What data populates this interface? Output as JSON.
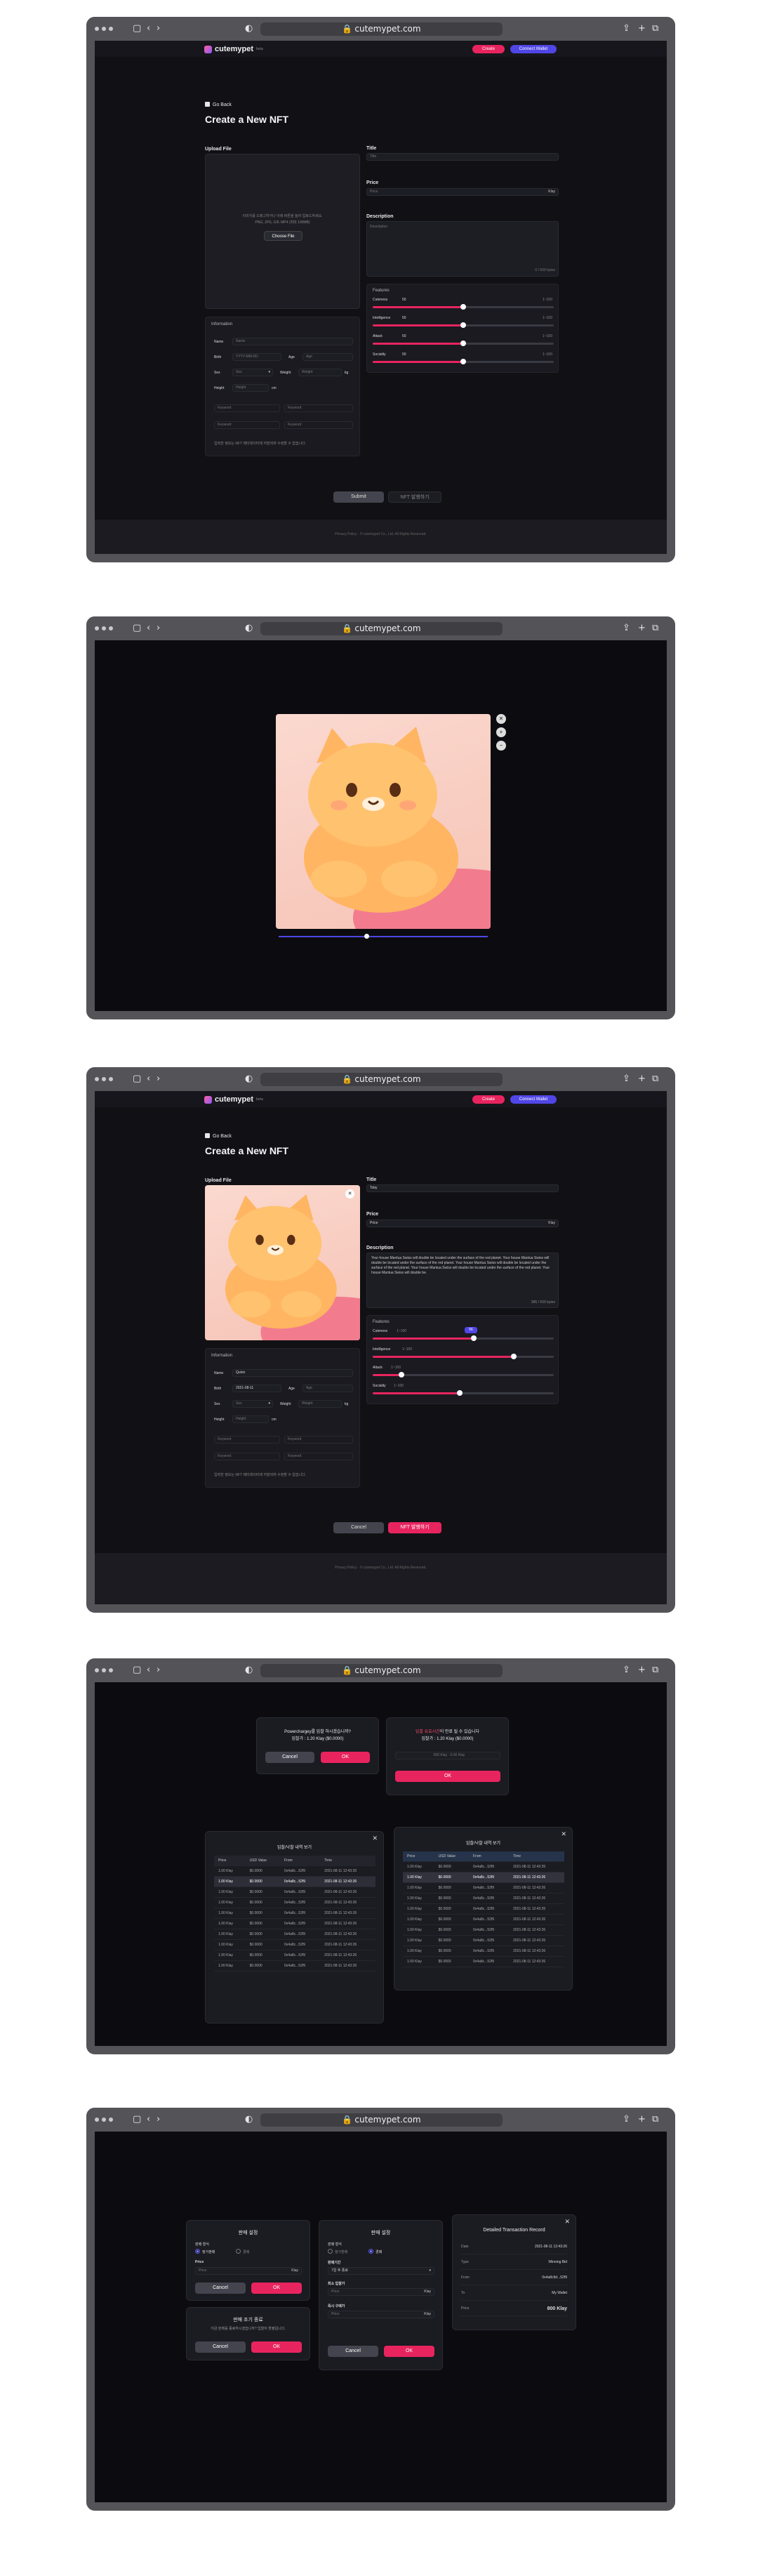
{
  "browser": {
    "url": "cutemypet.com"
  },
  "header": {
    "logo": "cutemypet",
    "logo_badge": "beta",
    "create_label": "Create",
    "connect_label": "Connect Wallet"
  },
  "page": {
    "back_label": "Go Back",
    "title": "Create a New NFT"
  },
  "upload": {
    "label": "Upload File",
    "hint_line1": "이미지를 드래그하거나 아래 버튼을 눌러 업로드하세요.",
    "hint_line2": "PNG, JPG, GIF, MP4 (최대 100MB)",
    "choose_label": "Choose File"
  },
  "form": {
    "title_label": "Title",
    "title_placeholder": "Title",
    "title_value": "Toby",
    "price_label": "Price",
    "price_placeholder": "Price",
    "price_value": "Price",
    "price_unit": "Klay",
    "description_label": "Description",
    "description_placeholder": "Description",
    "description_count": "0 / 500 bytes",
    "description_count_filled": "385 / 500 bytes",
    "description_text": "Your house Mantua Swiss will double be located under the surface of the red planet. Your house Mantua Swiss will double be located under the surface of the red planet. Your house Mantua Swiss will double be located under the surface of the red planet. Your house Mantua Swiss will double be located under the surface of the red planet. Your house Mantua Swiss will double be."
  },
  "features": {
    "label": "Features",
    "items": [
      {
        "name": "Cuteness",
        "value": "50",
        "hint": "1~100",
        "level": 0.5
      },
      {
        "name": "Intelligence",
        "value": "50",
        "hint": "1~100",
        "level": 0.5
      },
      {
        "name": "Attack",
        "value": "50",
        "hint": "1~100",
        "level": 0.5
      },
      {
        "name": "Sociality",
        "value": "50",
        "hint": "1~100",
        "level": 0.5
      }
    ],
    "filled_levels": [
      0.56,
      0.78,
      0.16,
      0.48
    ],
    "tooltip": "56"
  },
  "information": {
    "label": "Information",
    "name_label": "Name",
    "name_placeholder": "Name",
    "name_value": "Quinn",
    "birth_label": "Birth",
    "birth_placeholder": "YYYY-MM-DD",
    "birth_value": "2021-08-11",
    "age_label": "Age",
    "age_placeholder": "Age",
    "sex_label": "Sex",
    "sex_value": "Sex",
    "weight_label": "Weight",
    "weight_placeholder": "Weight",
    "weight_unit": "kg",
    "height_label": "Height",
    "height_placeholder": "Height",
    "height_unit": "cm",
    "keyword1": "Keyword",
    "keyword2": "Keyword",
    "keyword3": "Keyword",
    "keyword4": "Keyword",
    "note": "입력한 정보는 NFT 메타데이터에 저장되며 수정할 수 없습니다."
  },
  "actions": {
    "cancel": "Cancel",
    "submit": "Submit",
    "submit_alt": "NFT 발행하기"
  },
  "footer": {
    "text": "Privacy Policy · © cutemypet Co., Ltd. All Rights Reserved."
  },
  "dialogs": {
    "confirm1_line1": "Powerchargey를 입찰 하시겠습니까?",
    "confirm1_line2": "입찰가 : 1.20 Klay ($0.0000)",
    "confirm2_title_red": "입찰 유효시간",
    "confirm2_title_rest": "이 만료 될 수 있습니다",
    "confirm2_line2": "입찰가 : 1.20 Klay ($0.0000)",
    "confirm2_field": "000 Klay · 0.00 Klay",
    "cancel": "Cancel",
    "ok": "OK",
    "history_title": "입찰/낙찰 내역 보기",
    "history_cols": [
      "Price",
      "USD Value",
      "From",
      "Time"
    ],
    "history_rows": [
      [
        "1.00 Klay",
        "$0.0000",
        "0x4a8c...52f9",
        "2021-08-11 12:43:26"
      ],
      [
        "1.00 Klay",
        "$0.0000",
        "0x4a8c...52f9",
        "2021-08-11 12:43:26"
      ],
      [
        "1.00 Klay",
        "$0.0000",
        "0x4a8c...52f9",
        "2021-08-11 12:43:26"
      ],
      [
        "1.00 Klay",
        "$0.0000",
        "0x4a8c...52f9",
        "2021-08-11 12:43:26"
      ],
      [
        "1.00 Klay",
        "$0.0000",
        "0x4a8c...52f9",
        "2021-08-11 12:43:26"
      ],
      [
        "1.00 Klay",
        "$0.0000",
        "0x4a8c...52f9",
        "2021-08-11 12:43:26"
      ],
      [
        "1.00 Klay",
        "$0.0000",
        "0x4a8c...52f9",
        "2021-08-11 12:43:26"
      ],
      [
        "1.00 Klay",
        "$0.0000",
        "0x4a8c...52f9",
        "2021-08-11 12:43:26"
      ],
      [
        "1.00 Klay",
        "$0.0000",
        "0x4a8c...52f9",
        "2021-08-11 12:43:26"
      ],
      [
        "1.00 Klay",
        "$0.0000",
        "0x4a8c...52f9",
        "2021-08-11 12:43:26"
      ]
    ]
  },
  "sale": {
    "title": "판매 설정",
    "type_label": "판매 형식",
    "type_opt1": "정가판매",
    "type_opt2": "경매",
    "price_label": "Price",
    "price_placeholder": "Price",
    "price_unit": "Klay",
    "cancel": "Cancel",
    "ok": "OK",
    "period_label": "판매기간",
    "period_value": "7일 후 종료",
    "min_label": "최소 입찰가",
    "max_label": "즉시 구매가",
    "confirm_title": "판매 조기 종료",
    "confirm_text": "지금 판매를 종료하시겠습니까? 입찰자 환불됩니다.",
    "detail_title": "Detailed Transaction Record",
    "detail_rows": [
      {
        "k": "Date",
        "v": "2021-08-11 12:43:26"
      },
      {
        "k": "Type",
        "v": "Winning Bid"
      },
      {
        "k": "From",
        "v": "0x4a8c9d...52f9"
      },
      {
        "k": "To",
        "v": "My Wallet"
      },
      {
        "k": "Price",
        "v": "800 Klay"
      }
    ]
  }
}
